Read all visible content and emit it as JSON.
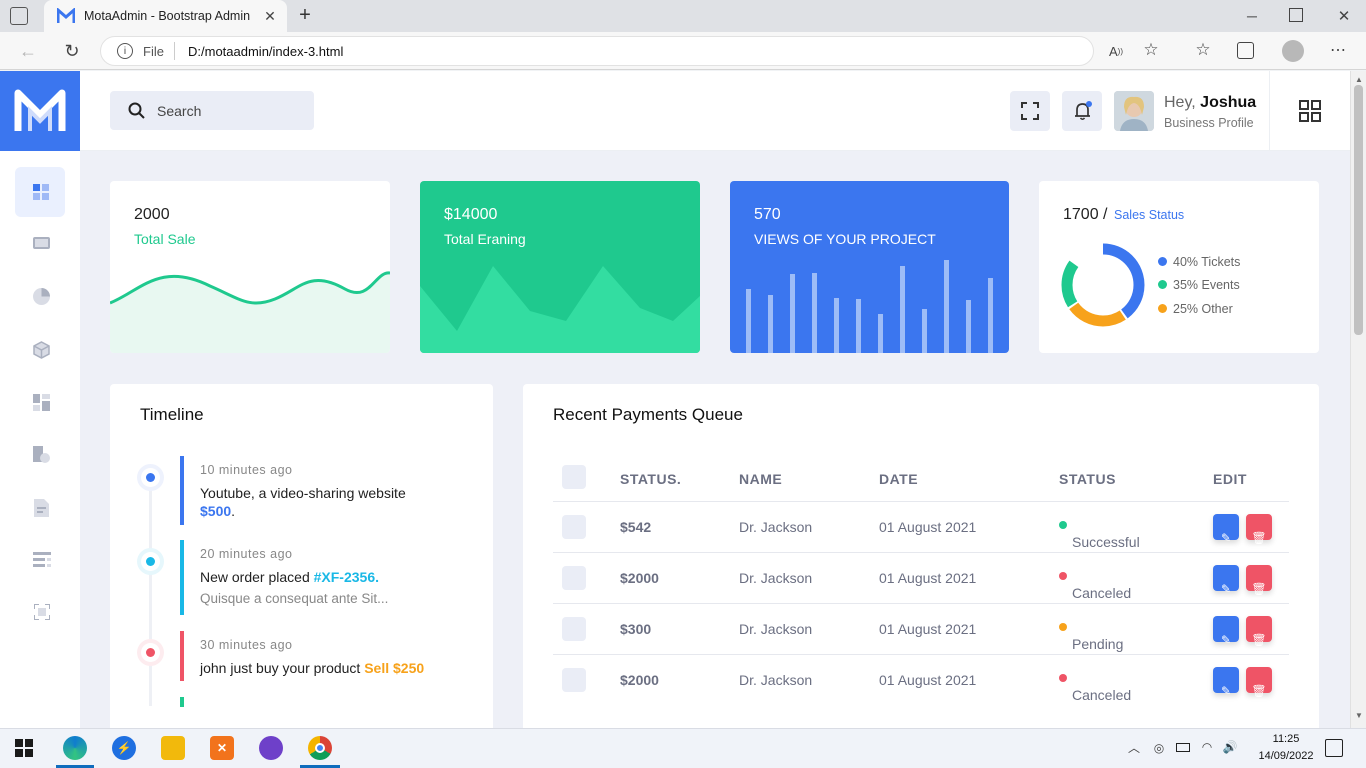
{
  "browser": {
    "tab_title": "MotaAdmin - Bootstrap Admin D",
    "url_prefix": "File",
    "url": "D:/motaadmin/index-3.html"
  },
  "header": {
    "search_placeholder": "Search",
    "greeting": "Hey,",
    "user_name": "Joshua",
    "user_role": "Business Profile"
  },
  "stats": [
    {
      "value": "2000",
      "label": "Total Sale"
    },
    {
      "value": "$14000",
      "label": "Total Eraning"
    },
    {
      "value": "570",
      "label": "VIEWS OF YOUR PROJECT"
    },
    {
      "value": "1700 /",
      "label": "Sales Status"
    }
  ],
  "sales_legend": [
    "40% Tickets",
    "35% Events",
    "25% Other"
  ],
  "colors": {
    "blue": "#3b76ef",
    "green": "#1fc98e",
    "orange": "#f7a21b",
    "red": "#ef5466"
  },
  "timeline": {
    "title": "Timeline",
    "items": [
      {
        "time": "10 minutes ago",
        "text": "Youtube, a video-sharing website",
        "highlight": "$500",
        "suffix": "."
      },
      {
        "time": "20 minutes ago",
        "text": "New order placed",
        "highlight": "#XF-2356.",
        "sub": "Quisque a consequat ante Sit..."
      },
      {
        "time": "30 minutes ago",
        "text": "john just buy your product",
        "highlight": "Sell $250"
      }
    ]
  },
  "payments": {
    "title": "Recent Payments Queue",
    "columns": [
      "STATUS.",
      "NAME",
      "DATE",
      "STATUS",
      "EDIT"
    ],
    "rows": [
      {
        "amount": "$542",
        "name": "Dr. Jackson",
        "date": "01 August 2021",
        "status": "Successful"
      },
      {
        "amount": "$2000",
        "name": "Dr. Jackson",
        "date": "01 August 2021",
        "status": "Canceled"
      },
      {
        "amount": "$300",
        "name": "Dr. Jackson",
        "date": "01 August 2021",
        "status": "Pending"
      },
      {
        "amount": "$2000",
        "name": "Dr. Jackson",
        "date": "01 August 2021",
        "status": "Canceled"
      }
    ]
  },
  "taskbar": {
    "time": "11:25",
    "date": "14/09/2022"
  }
}
